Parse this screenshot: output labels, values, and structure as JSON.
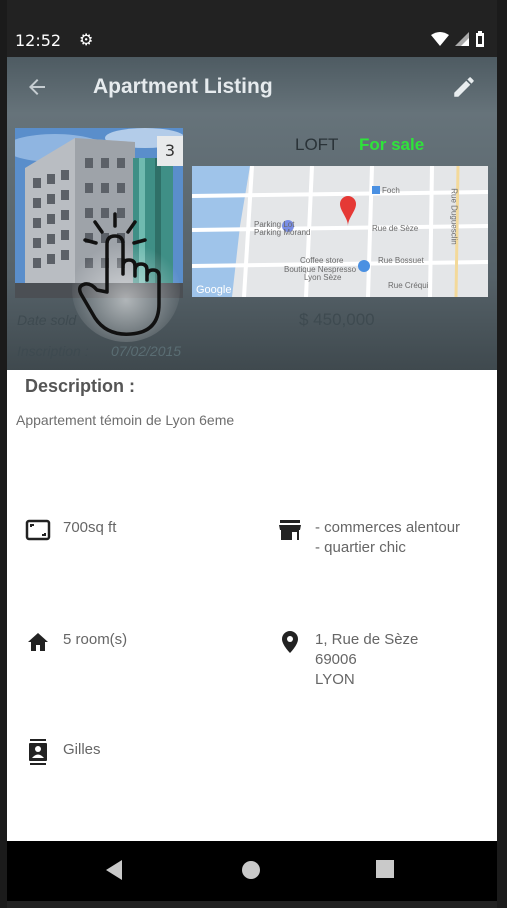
{
  "status": {
    "time": "12:52"
  },
  "appbar": {
    "title": "Apartment Listing"
  },
  "listing": {
    "photo_count": "3",
    "type": "LOFT",
    "sale_status": "For sale",
    "date_sold_label": "Date sold",
    "price": "$ 450,000",
    "inscription_label": "Inscription :",
    "inscription_date": "07/02/2015",
    "map": {
      "labels": [
        "Foch",
        "Rue de Sèze",
        "Parking Lot",
        "Parking Morand",
        "Coffee store",
        "Boutique Nespresso",
        "Lyon Sèze",
        "Rue Bossuet",
        "Rue Créqui",
        "Rue Duguesclin",
        "Google"
      ]
    }
  },
  "description": {
    "heading": "Description :",
    "text": "Appartement témoin de Lyon 6eme"
  },
  "features": {
    "surface": "700sq ft",
    "shops_line1": "- commerces alentour",
    "shops_line2": "- quartier chic",
    "rooms": "5 room(s)",
    "address_line1": "1, Rue de Sèze",
    "address_line2": "69006",
    "address_line3": "LYON",
    "agent": "Gilles"
  },
  "colors": {
    "sale_green": "#2ee33a",
    "appbar_dim": "#5e6b72"
  }
}
